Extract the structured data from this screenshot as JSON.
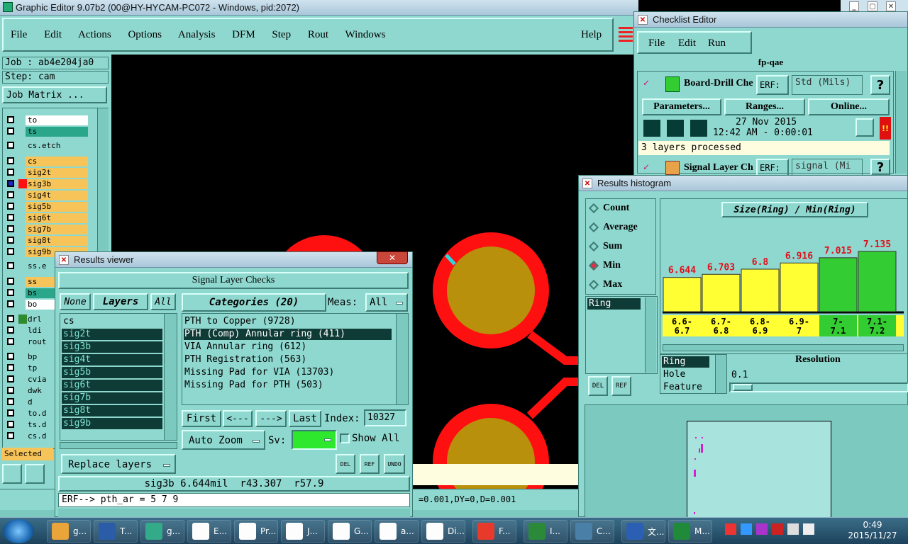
{
  "main": {
    "title": "Graphic Editor 9.07b2 (00@HY-HYCAM-PC072 - Windows, pid:2072)",
    "menu": [
      "File",
      "Edit",
      "Actions",
      "Options",
      "Analysis",
      "DFM",
      "Step",
      "Rout",
      "Windows"
    ],
    "help": "Help",
    "job": "Job : ab4e204ja0",
    "step": "Step: cam",
    "job_matrix": "Job Matrix ...",
    "layers": [
      "to",
      "ts",
      "cs.etch",
      "cs",
      "sig2t",
      "sig3b",
      "sig4t",
      "sig5b",
      "sig6t",
      "sig7b",
      "sig8t",
      "sig9b",
      "ss.e",
      "ss",
      "bs",
      "bo",
      "drl",
      "ldi",
      "rout",
      "bp",
      "tp",
      "cvia",
      "dwk",
      "d",
      "to.d",
      "ts.d",
      "cs.d"
    ],
    "selected": "Selected",
    "status_line": "=0.001,DY=0,D=0.001"
  },
  "checklist": {
    "title": "Checklist Editor",
    "menu": [
      "File",
      "Edit",
      "Run"
    ],
    "name": "fp-qae",
    "item1": {
      "label": "Board-Drill Che",
      "erf": "ERF:",
      "erf_value": "Std (Mils)",
      "help": "?"
    },
    "buttons": [
      "Parameters...",
      "Ranges...",
      "Online..."
    ],
    "date": "27 Nov 2015",
    "time": "12:42 AM - 0:00:01",
    "processed": "3 layers processed",
    "item2": {
      "label": "Signal Layer Ch",
      "erf": "ERF:",
      "erf_value": "signal (Mi",
      "help": "?"
    },
    "alert": "!!"
  },
  "histogram": {
    "title": "Results histogram",
    "options": [
      "Count",
      "Average",
      "Sum",
      "Min",
      "Max"
    ],
    "selected_option": "Min",
    "header": "Size(Ring) / Min(Ring)",
    "list_item": "Ring",
    "type_list": [
      "Ring",
      "Hole",
      "Feature"
    ],
    "resolution_label": "Resolution",
    "resolution_value": "0.1",
    "del": "DEL",
    "ref": "REF"
  },
  "chart_data": {
    "type": "bar",
    "title": "Size(Ring) / Min(Ring)",
    "categories": [
      "6.6-6.7",
      "6.7-6.8",
      "6.8-6.9",
      "6.9-7",
      "7-7.1",
      "7.1-7.2"
    ],
    "category_lines": [
      [
        "6.6-",
        "6.7"
      ],
      [
        "6.7-",
        "6.8"
      ],
      [
        "6.8-",
        "6.9"
      ],
      [
        "6.9-",
        "7"
      ],
      [
        "7-",
        "7.1"
      ],
      [
        "7.1-",
        "7.2"
      ]
    ],
    "values": [
      6.644,
      6.703,
      6.8,
      6.916,
      7.015,
      7.135
    ],
    "labels": [
      "6.644",
      "6.703",
      "6.8",
      "6.916",
      "7.015",
      "7.135"
    ],
    "colors": [
      "#ffff33",
      "#ffff33",
      "#ffff33",
      "#ffff33",
      "#33cc33",
      "#33cc33"
    ],
    "label_color": "#e0101a",
    "ylim": [
      0,
      7.2
    ]
  },
  "results": {
    "title": "Results viewer",
    "header": "Signal Layer Checks",
    "none": "None",
    "layers_label": "Layers",
    "all": "All",
    "layers": [
      "cs",
      "sig2t",
      "sig3b",
      "sig4t",
      "sig5b",
      "sig6t",
      "sig7b",
      "sig8t",
      "sig9b"
    ],
    "categories_label": "Categories (20)",
    "meas_label": "Meas:",
    "meas_value": "All",
    "categories": [
      "PTH to Copper (9728)",
      "PTH (Comp) Annular ring (411)",
      "VIA Annular ring (612)",
      "PTH Registration (563)",
      "Missing Pad for VIA (13703)",
      "Missing Pad for PTH (503)"
    ],
    "nav": [
      "First",
      "<---",
      "--->",
      "Last"
    ],
    "index_label": "Index:",
    "index_value": "10327",
    "auto_zoom": "Auto Zoom",
    "sv_label": "Sv:",
    "show_all": "Show All",
    "replace_layers": "Replace layers",
    "del": "DEL",
    "ref": "REF",
    "undo": "UNDO",
    "status": "sig3b 6.644mil  r43.307  r57.9",
    "erf_line": "ERF--> pth_ar = 5 7 9"
  },
  "taskbar": {
    "items": [
      "g...",
      "T...",
      "g...",
      "E...",
      "Pr...",
      "J...",
      "G...",
      "a...",
      "Di...",
      "F...",
      "I...",
      "C...",
      "文...",
      "M..."
    ],
    "time": "0:49",
    "date": "2015/11/27"
  }
}
